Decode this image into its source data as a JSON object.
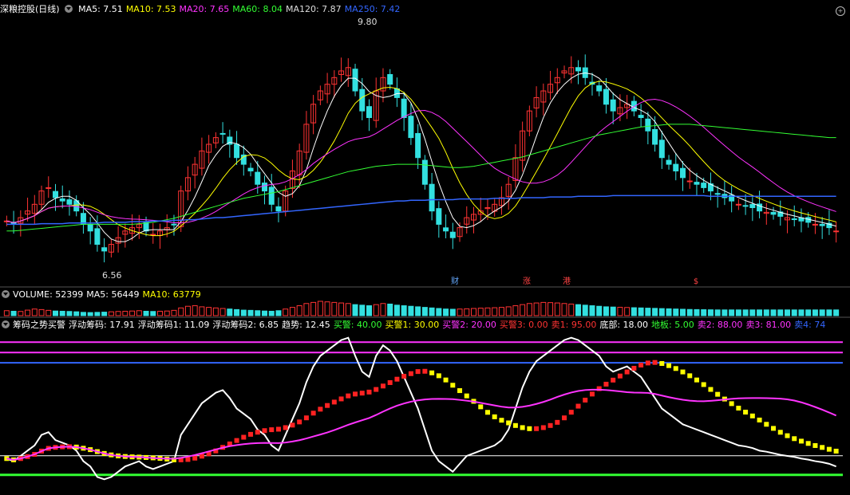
{
  "main_header": {
    "title": "深粮控股(日线)",
    "items": [
      {
        "label": "MA5: 7.51",
        "color": "#ffffff"
      },
      {
        "label": "MA10: 7.53",
        "color": "#ffff00"
      },
      {
        "label": "MA20: 7.65",
        "color": "#ff33ff"
      },
      {
        "label": "MA60: 8.04",
        "color": "#33ff33"
      },
      {
        "label": "MA120: 7.87",
        "color": "#dddddd"
      },
      {
        "label": "MA250: 7.42",
        "color": "#3366ff"
      }
    ]
  },
  "annotations": {
    "high": "9.80",
    "low": "6.56"
  },
  "event_tags": [
    {
      "text": "财",
      "color": "#66aaff"
    },
    {
      "text": "涨",
      "color": "#ff4444"
    },
    {
      "text": "港",
      "color": "#ff4444"
    },
    {
      "text": "$",
      "color": "#ff4444"
    }
  ],
  "volume_header": {
    "items": [
      {
        "label": "VOLUME: 52399",
        "color": "#ffffff"
      },
      {
        "label": "MA5: 56449",
        "color": "#ffffff"
      },
      {
        "label": "MA10: 63779",
        "color": "#ffff00"
      }
    ]
  },
  "indicator_header": {
    "items": [
      {
        "label": "筹码之势买警",
        "color": "#ffffff"
      },
      {
        "label": "浮动筹码: 17.91",
        "color": "#ffffff"
      },
      {
        "label": "浮动筹码1: 11.09",
        "color": "#ffffff"
      },
      {
        "label": "浮动筹码2: 6.85",
        "color": "#ffffff"
      },
      {
        "label": "趋势: 12.45",
        "color": "#ffffff"
      },
      {
        "label": "买警: 40.00",
        "color": "#33ff33"
      },
      {
        "label": "买警1: 30.00",
        "color": "#ffff00"
      },
      {
        "label": "买警2: 20.00",
        "color": "#ff33ff"
      },
      {
        "label": "买警3: 0.00",
        "color": "#ff3333"
      },
      {
        "label": "卖1: 95.00",
        "color": "#ff3333"
      },
      {
        "label": "底部: 18.00",
        "color": "#ffffff"
      },
      {
        "label": "地板: 5.00",
        "color": "#33ff33"
      },
      {
        "label": "卖2: 88.00",
        "color": "#ff33ff"
      },
      {
        "label": "卖3: 81.00",
        "color": "#ff33ff"
      },
      {
        "label": "卖4: 74",
        "color": "#3366ff"
      }
    ]
  },
  "chart_data": {
    "type": "candlestick",
    "n": 120,
    "price_ylim": [
      6.3,
      10.1
    ],
    "close": [
      7.05,
      7.0,
      7.1,
      7.2,
      7.3,
      7.5,
      7.55,
      7.4,
      7.35,
      7.3,
      7.2,
      7.0,
      6.9,
      6.7,
      6.6,
      6.7,
      6.8,
      6.9,
      6.95,
      7.0,
      6.9,
      6.85,
      6.9,
      6.95,
      7.0,
      7.5,
      7.7,
      7.9,
      8.1,
      8.2,
      8.3,
      8.35,
      8.2,
      8.0,
      7.9,
      7.8,
      7.6,
      7.5,
      7.3,
      7.2,
      7.5,
      7.8,
      8.1,
      8.5,
      8.8,
      9.0,
      9.1,
      9.2,
      9.3,
      9.35,
      9.0,
      8.7,
      8.6,
      9.0,
      9.2,
      9.1,
      8.9,
      8.6,
      8.3,
      8.0,
      7.6,
      7.2,
      7.0,
      6.9,
      6.8,
      6.95,
      7.1,
      7.15,
      7.2,
      7.25,
      7.3,
      7.4,
      7.6,
      8.0,
      8.4,
      8.7,
      8.9,
      9.0,
      9.1,
      9.2,
      9.3,
      9.35,
      9.3,
      9.2,
      9.1,
      9.0,
      8.8,
      8.7,
      8.75,
      8.8,
      8.7,
      8.6,
      8.4,
      8.2,
      8.0,
      7.9,
      7.8,
      7.7,
      7.65,
      7.6,
      7.55,
      7.5,
      7.45,
      7.4,
      7.35,
      7.3,
      7.28,
      7.25,
      7.2,
      7.18,
      7.15,
      7.12,
      7.1,
      7.08,
      7.05,
      7.03,
      7.0,
      6.98,
      6.95,
      6.9
    ],
    "ma60": [
      6.9,
      6.9,
      6.91,
      6.92,
      6.93,
      6.94,
      6.95,
      6.96,
      6.97,
      6.98,
      6.99,
      7.0,
      7.0,
      7.0,
      7.0,
      7.0,
      7.0,
      7.0,
      7.0,
      7.01,
      7.02,
      7.03,
      7.05,
      7.07,
      7.09,
      7.12,
      7.15,
      7.18,
      7.21,
      7.24,
      7.27,
      7.3,
      7.33,
      7.36,
      7.39,
      7.41,
      7.43,
      7.45,
      7.47,
      7.49,
      7.52,
      7.55,
      7.58,
      7.61,
      7.64,
      7.67,
      7.7,
      7.73,
      7.76,
      7.79,
      7.81,
      7.83,
      7.85,
      7.87,
      7.88,
      7.89,
      7.9,
      7.9,
      7.9,
      7.9,
      7.89,
      7.88,
      7.87,
      7.86,
      7.85,
      7.85,
      7.86,
      7.87,
      7.89,
      7.91,
      7.93,
      7.95,
      7.97,
      7.99,
      8.01,
      8.04,
      8.07,
      8.1,
      8.13,
      8.16,
      8.19,
      8.22,
      8.25,
      8.28,
      8.31,
      8.34,
      8.36,
      8.38,
      8.4,
      8.42,
      8.44,
      8.46,
      8.47,
      8.48,
      8.49,
      8.5,
      8.5,
      8.5,
      8.5,
      8.49,
      8.48,
      8.47,
      8.46,
      8.45,
      8.44,
      8.43,
      8.42,
      8.41,
      8.4,
      8.39,
      8.38,
      8.37,
      8.36,
      8.35,
      8.34,
      8.33,
      8.32,
      8.31,
      8.3,
      8.3
    ],
    "ma250": [
      7.0,
      7.0,
      7.0,
      7.0,
      7.0,
      7.01,
      7.01,
      7.01,
      7.01,
      7.02,
      7.02,
      7.02,
      7.02,
      7.02,
      7.03,
      7.03,
      7.03,
      7.03,
      7.04,
      7.04,
      7.04,
      7.05,
      7.05,
      7.05,
      7.06,
      7.06,
      7.07,
      7.07,
      7.08,
      7.09,
      7.1,
      7.1,
      7.11,
      7.12,
      7.13,
      7.14,
      7.15,
      7.16,
      7.17,
      7.18,
      7.19,
      7.2,
      7.21,
      7.22,
      7.23,
      7.24,
      7.25,
      7.26,
      7.27,
      7.28,
      7.29,
      7.3,
      7.31,
      7.32,
      7.33,
      7.34,
      7.35,
      7.35,
      7.36,
      7.36,
      7.36,
      7.37,
      7.37,
      7.37,
      7.37,
      7.38,
      7.38,
      7.38,
      7.38,
      7.38,
      7.39,
      7.39,
      7.39,
      7.39,
      7.4,
      7.4,
      7.4,
      7.4,
      7.41,
      7.41,
      7.41,
      7.41,
      7.42,
      7.42,
      7.42,
      7.42,
      7.42,
      7.43,
      7.43,
      7.43,
      7.43,
      7.43,
      7.43,
      7.43,
      7.43,
      7.43,
      7.43,
      7.43,
      7.43,
      7.43,
      7.43,
      7.42,
      7.42,
      7.42,
      7.42,
      7.42,
      7.42,
      7.42,
      7.42,
      7.42,
      7.42,
      7.42,
      7.42,
      7.42,
      7.42,
      7.42,
      7.42,
      7.42,
      7.42,
      7.42
    ],
    "volume": [
      45,
      40,
      38,
      50,
      60,
      55,
      48,
      42,
      40,
      38,
      35,
      30,
      28,
      30,
      32,
      35,
      38,
      40,
      42,
      45,
      40,
      38,
      40,
      42,
      48,
      70,
      85,
      90,
      80,
      75,
      70,
      65,
      60,
      55,
      50,
      48,
      45,
      42,
      40,
      45,
      60,
      75,
      90,
      110,
      120,
      130,
      125,
      120,
      115,
      110,
      100,
      95,
      90,
      100,
      110,
      105,
      95,
      90,
      85,
      80,
      75,
      70,
      65,
      60,
      58,
      60,
      62,
      65,
      68,
      70,
      72,
      75,
      80,
      90,
      100,
      110,
      115,
      120,
      118,
      115,
      110,
      105,
      100,
      95,
      90,
      85,
      80,
      78,
      76,
      74,
      72,
      70,
      68,
      66,
      64,
      62,
      60,
      58,
      56,
      55,
      54,
      53,
      52,
      52,
      52,
      52,
      52,
      52,
      52,
      52,
      52,
      52,
      52,
      52,
      52,
      52,
      52,
      52,
      52,
      52
    ]
  }
}
